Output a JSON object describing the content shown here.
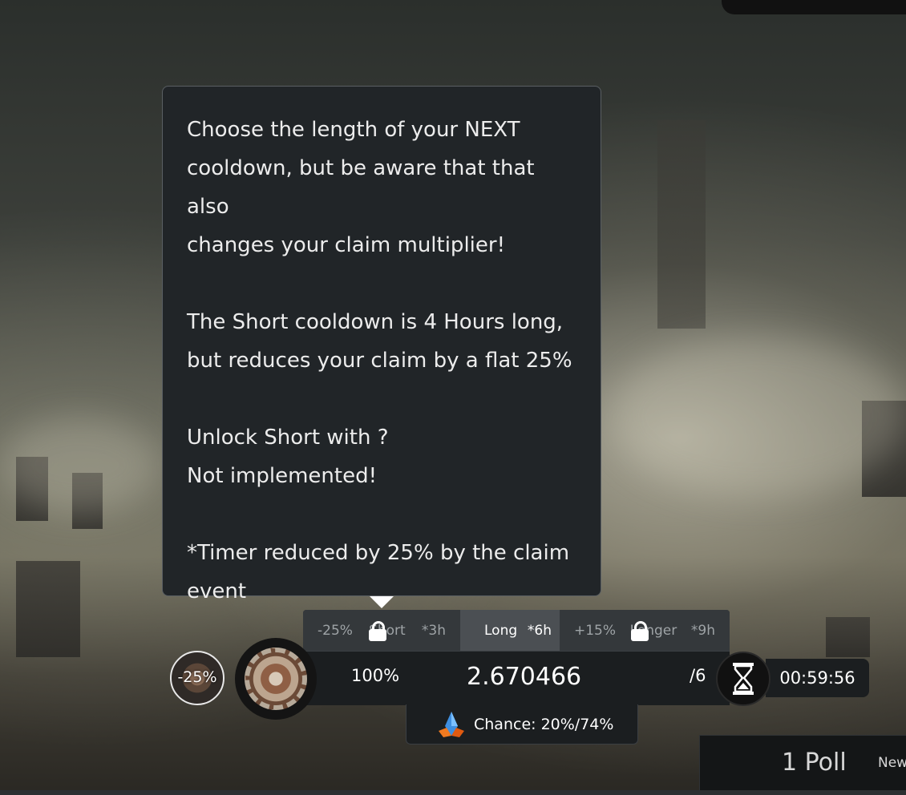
{
  "tooltip": {
    "line1": "Choose the length of your NEXT",
    "line2": "cooldown, but be aware that that also",
    "line3": "changes your claim multiplier!",
    "line4": "The Short cooldown is 4 Hours long,",
    "line5": "but reduces your claim by a flat 25%",
    "line6": "Unlock Short with ?",
    "line7": "Not implemented!",
    "line8": "*Timer reduced by 25% by the claim",
    "line9": "event"
  },
  "cooldown_options": {
    "short": {
      "modifier": "-25%",
      "label": "Short",
      "time": "*3h",
      "locked": true
    },
    "long": {
      "label": "Long",
      "time": "*6h",
      "selected": true
    },
    "longer": {
      "modifier": "+15%",
      "label": "Longer",
      "time": "*9h",
      "locked": true
    }
  },
  "claim": {
    "badge_modifier": "-25%",
    "multiplier": "100%",
    "value": "2.670466",
    "count": "/6",
    "timer": "00:59:56",
    "chance": "Chance: 20%/74%"
  },
  "poll": {
    "count": "1 Poll",
    "new_label": "New"
  },
  "icons": {
    "badge_small": "gear-medallion-icon",
    "badge_big": "gear-medallion-icon",
    "timer": "hourglass-icon",
    "chance": "crystal-icon",
    "lock": "lock-icon"
  },
  "colors": {
    "tooltip_bg": "#212528",
    "bar_bg": "#1b1e20",
    "selected_option_bg": "#4b4f53"
  }
}
